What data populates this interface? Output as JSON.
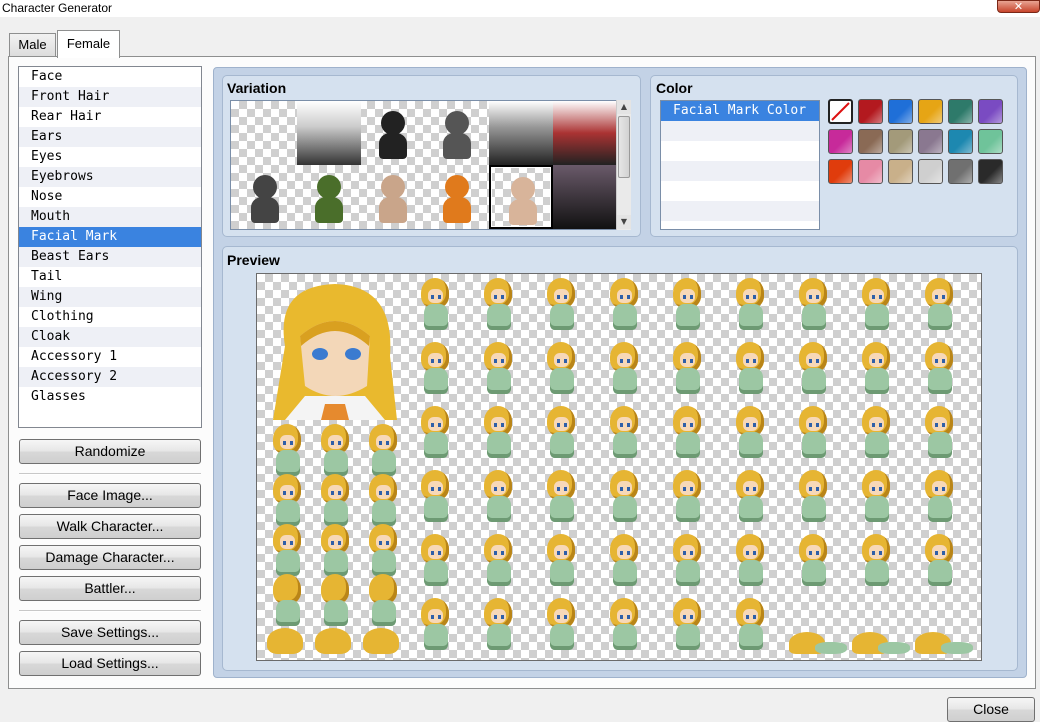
{
  "window": {
    "title": "Character Generator",
    "close_glyph": "✕"
  },
  "tabs": [
    {
      "label": "Male",
      "active": false
    },
    {
      "label": "Female",
      "active": true
    }
  ],
  "parts": [
    {
      "label": "Face"
    },
    {
      "label": "Front Hair"
    },
    {
      "label": "Rear Hair"
    },
    {
      "label": "Ears"
    },
    {
      "label": "Eyes"
    },
    {
      "label": "Eyebrows"
    },
    {
      "label": "Nose"
    },
    {
      "label": "Mouth"
    },
    {
      "label": "Facial Mark",
      "selected": true
    },
    {
      "label": "Beast Ears"
    },
    {
      "label": "Tail"
    },
    {
      "label": "Wing"
    },
    {
      "label": "Clothing"
    },
    {
      "label": "Cloak"
    },
    {
      "label": "Accessory 1"
    },
    {
      "label": "Accessory 2"
    },
    {
      "label": "Glasses"
    }
  ],
  "buttons": {
    "randomize": "Randomize",
    "face_image": "Face Image...",
    "walk_character": "Walk Character...",
    "damage_character": "Damage Character...",
    "battler": "Battler...",
    "save_settings": "Save Settings...",
    "load_settings": "Load Settings...",
    "close": "Close"
  },
  "variation": {
    "label": "Variation",
    "selected_index": 11
  },
  "color": {
    "label": "Color",
    "items": [
      "Facial Mark Color"
    ],
    "swatches": [
      "none",
      "#b3191f",
      "#1f6fd8",
      "#e6a515",
      "#2e7a6a",
      "#7a4bc2",
      "#c72a9a",
      "#8a6a55",
      "#a39a7a",
      "#8a7890",
      "#1d88b0",
      "#6fc39a",
      "#e03c0c",
      "#e68aa5",
      "#c9b08a",
      "#cfcfcf",
      "#707070",
      "#2a2a2a"
    ]
  },
  "preview": {
    "label": "Preview"
  },
  "icons": {
    "scroll_up": "scroll-up-icon",
    "scroll_down": "scroll-down-icon",
    "no_color": "no-color-icon"
  }
}
